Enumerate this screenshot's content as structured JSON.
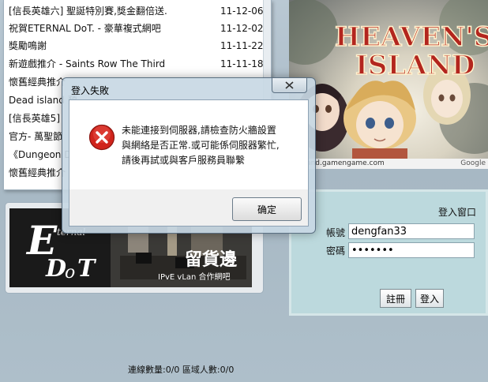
{
  "news": [
    {
      "title": "[信長英雄六] 聖誕特別賽,獎金翻倍送.",
      "date": "11-12-06"
    },
    {
      "title": "祝賀ETERNAL DoT. - 豪華複式網吧",
      "date": "11-12-02"
    },
    {
      "title": "獎勵鳴謝",
      "date": "11-11-22"
    },
    {
      "title": "新遊戲推介 - Saints Row The Third",
      "date": "11-11-18"
    },
    {
      "title": "懷舊經典推介",
      "date": ""
    },
    {
      "title": "Dead island 預",
      "date": ""
    },
    {
      "title": "[信長英雄5]",
      "date": ""
    },
    {
      "title": "官方- 萬聖節",
      "date": ""
    },
    {
      "title": "《Dungeon D",
      "date": ""
    },
    {
      "title": "懷舊經典推介",
      "date": ""
    }
  ],
  "game_banner": {
    "logo_line1": "HEAVEN'S",
    "logo_line2": "ISLAND",
    "url": "hsisland.gamengame.com",
    "google": "Google"
  },
  "cafe_banner": {
    "logo_main": "E",
    "logo_small": "ternal",
    "logo_dot": "D",
    "logo_o": "o",
    "logo_t": "T",
    "chinese_name": "留貨邊",
    "subtitle": "IPvE vLan 合作網吧"
  },
  "login": {
    "title": "登入窗口",
    "username_label": "帳號",
    "username_value": "dengfan33",
    "password_label": "密碼",
    "password_value": "dengfan",
    "register_label": "註冊",
    "login_label": "登入"
  },
  "status": {
    "connections": "連線數量:0/0",
    "area_users": "區域人數:0/0"
  },
  "dialog": {
    "title": "登入失敗",
    "message_lines": [
      "未能連接到伺服器,請檢查防火牆設置",
      "與網絡是否正常.或可能係伺服器繁忙,",
      "請後再試或與客戶服務員聯繫"
    ],
    "ok_label": "确定"
  }
}
